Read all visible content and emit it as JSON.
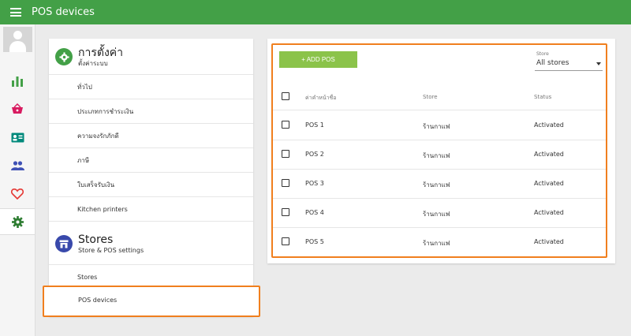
{
  "topbar": {
    "title": "POS devices",
    "menu_icon": "hamburger-menu-icon",
    "background": "#43a047"
  },
  "rail": {
    "avatar_icon": "user-avatar-icon",
    "items": [
      {
        "icon": "bar-chart-icon",
        "color": "#43a047"
      },
      {
        "icon": "basket-icon",
        "color": "#d81b60"
      },
      {
        "icon": "id-card-icon",
        "color": "#00897b"
      },
      {
        "icon": "people-icon",
        "color": "#3f51b5"
      },
      {
        "icon": "heart-icon",
        "color": "#e53935"
      },
      {
        "icon": "gear-icon",
        "color": "#2e7d32",
        "active": true
      }
    ]
  },
  "settings": {
    "title": "การตั้งค่า",
    "subtitle": "ตั้งค่าระบบ",
    "items": [
      "ทั่วไป",
      "ประเภทการชำระเงิน",
      "ความจงรักภักดี",
      "ภาษี",
      "ใบเสร็จรับเงิน",
      "Kitchen printers"
    ]
  },
  "stores": {
    "title": "Stores",
    "subtitle": "Store & POS settings",
    "items": [
      "Stores",
      "POS devices"
    ]
  },
  "devices": {
    "add_button": "+ ADD POS",
    "store_filter": {
      "label": "Store",
      "value": "All stores"
    },
    "columns": [
      "ค่าคำหน้าชื่อ",
      "Store",
      "Status"
    ],
    "rows": [
      {
        "name": "POS 1",
        "store": "ร้านกาแฟ",
        "status": "Activated"
      },
      {
        "name": "POS 2",
        "store": "ร้านกาแฟ",
        "status": "Activated"
      },
      {
        "name": "POS 3",
        "store": "ร้านกาแฟ",
        "status": "Activated"
      },
      {
        "name": "POS 4",
        "store": "ร้านกาแฟ",
        "status": "Activated"
      },
      {
        "name": "POS 5",
        "store": "ร้านกาแฟ",
        "status": "Activated"
      }
    ]
  },
  "colors": {
    "accent": "#43a047",
    "add_button": "#8bc34a",
    "highlight": "#f07f1e",
    "stores_icon": "#3949ab"
  }
}
